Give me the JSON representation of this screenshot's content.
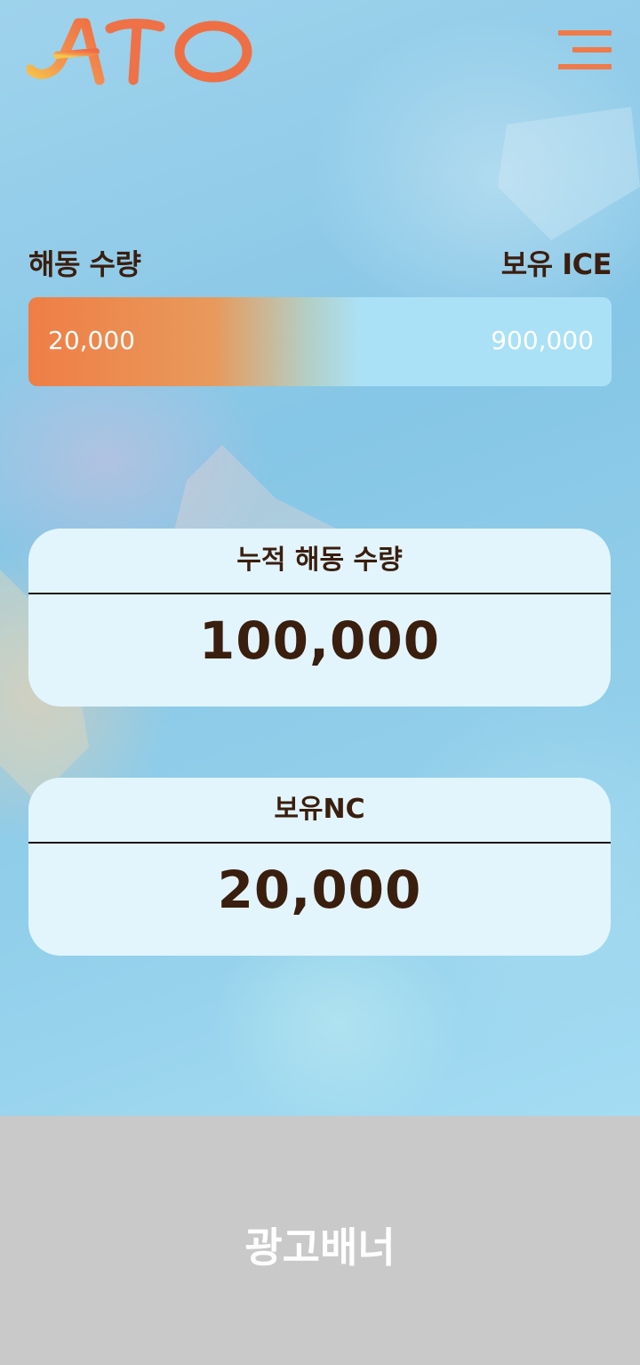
{
  "header": {
    "logo_text": "ATO",
    "brand_color": "#ef7a4a",
    "menu_icon": "hamburger-menu-icon"
  },
  "thaw": {
    "left_label": "해동 수량",
    "right_label": "보유 ICE",
    "min_value": "20,000",
    "max_value": "900,000"
  },
  "cards": {
    "cumulative": {
      "title": "누적 해동 수량",
      "value": "100,000"
    },
    "nc": {
      "title": "보유NC",
      "value": "20,000"
    }
  },
  "ad_banner": {
    "label": "광고배너"
  },
  "colors": {
    "text_dark": "#3a1e0e",
    "card_bg": "#e2f5fd",
    "bar_start": "#ef7e45",
    "bar_end": "#abe1f6",
    "ad_bg": "#c9c9c9"
  }
}
